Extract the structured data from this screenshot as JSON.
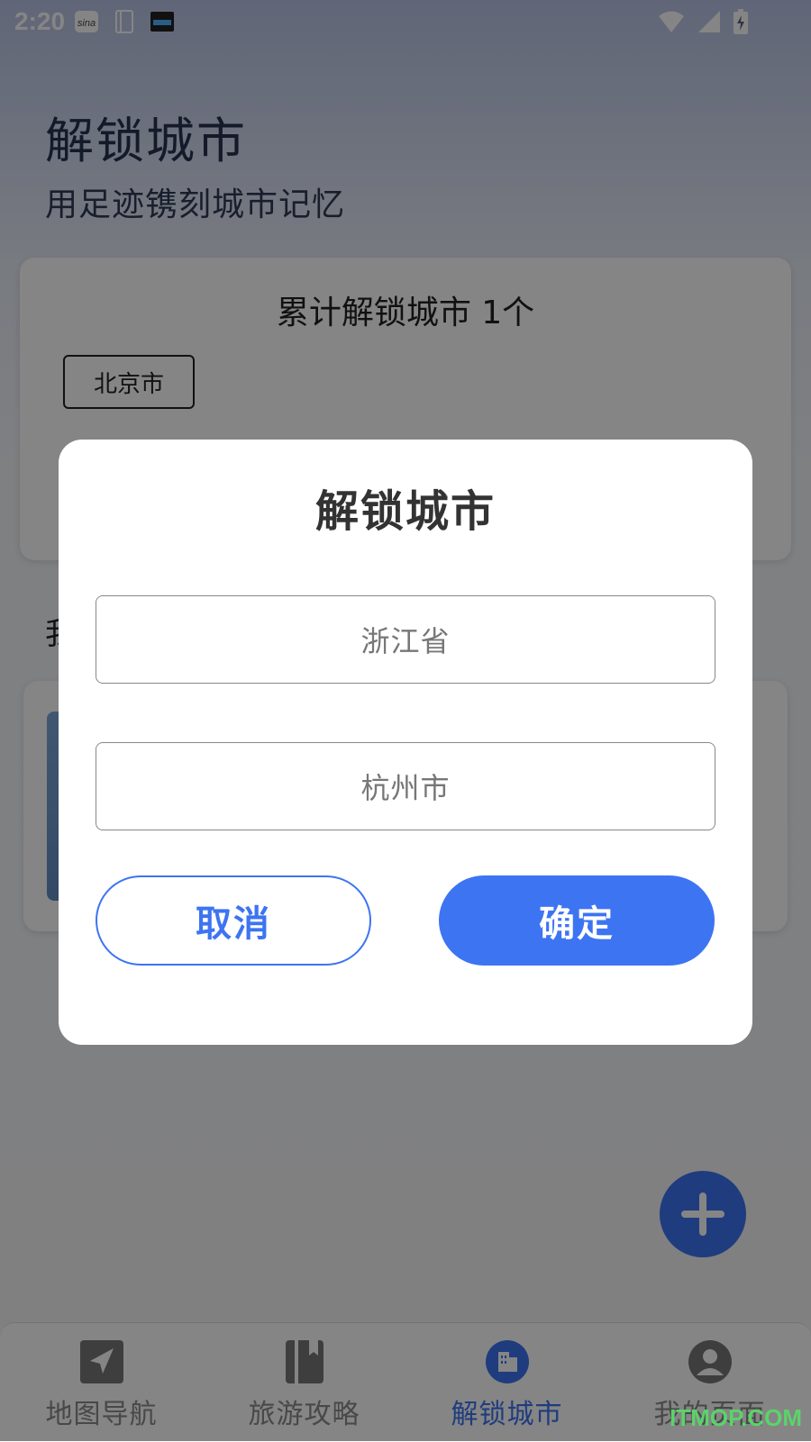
{
  "status_bar": {
    "time": "2:20"
  },
  "header": {
    "title": "解锁城市",
    "subtitle": "用足迹镌刻城市记忆"
  },
  "summary_card": {
    "heading": "累计解锁城市 1个",
    "cities": [
      "北京市"
    ]
  },
  "section": {
    "label": "我"
  },
  "bottom_nav": {
    "items": [
      {
        "label": "地图导航",
        "icon": "navigation-arrow-icon"
      },
      {
        "label": "旅游攻略",
        "icon": "guide-book-icon"
      },
      {
        "label": "解锁城市",
        "icon": "city-buildings-icon",
        "active": true
      },
      {
        "label": "我的页面",
        "icon": "user-icon"
      }
    ]
  },
  "dialog": {
    "title": "解锁城市",
    "province_value": "浙江省",
    "city_value": "杭州市",
    "cancel_label": "取消",
    "confirm_label": "确定"
  },
  "colors": {
    "accent": "#3d74f2",
    "overlay": "rgba(0,0,0,0.48)"
  },
  "watermark": "ITMOP.COM"
}
